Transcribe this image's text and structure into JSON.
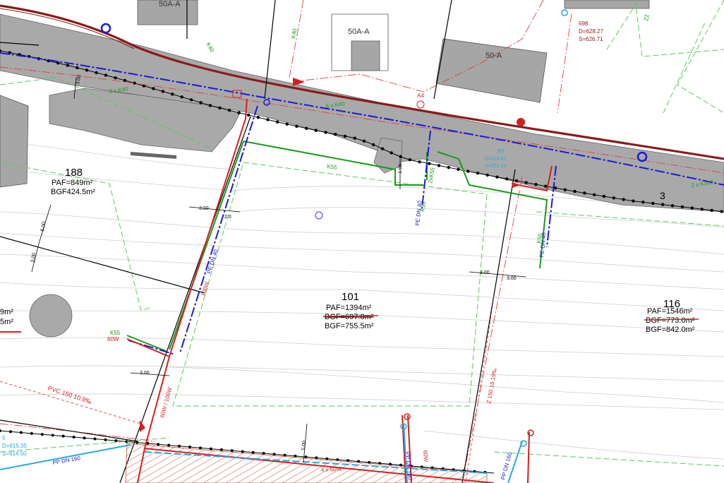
{
  "colors": {
    "road": "#a9a9a9",
    "building": "#a6a6a6",
    "parcel_line": "#000000",
    "contour": "#c8c8c8",
    "setback_green": "#5cc85c",
    "water_green": "#1a9a1a",
    "gas_blue": "#1a1ad6",
    "sewer_red": "#d42020",
    "main_road_edge": "#8b1a1a",
    "pp_cyan": "#29a8e0",
    "elec_red_dash": "#e04040"
  },
  "buildings": {
    "b50a_top": "50A-A",
    "b50a": "50A-A",
    "b50a_right": "50-A"
  },
  "parcels": {
    "p188": {
      "number": "188",
      "paf": "PAF=849m²",
      "bgf": "BGF424.5m²"
    },
    "p101": {
      "number": "101",
      "paf": "PAF=1394m²",
      "bgf_old": "BGF=697.0m²",
      "bgf": "BGF=755.5m²"
    },
    "p116": {
      "number": "116",
      "paf": "PAF=1546m²",
      "bgf_old": "BGF=773.0m²",
      "bgf": "BGF=842.0m²"
    },
    "p3": {
      "number": "3"
    },
    "left_partial": {
      "line1": "9m²",
      "line2": "5m²"
    }
  },
  "utilities": {
    "k40_top": "K40",
    "k40_left": "K40",
    "k40_2x": "2 x K40",
    "k40_6x": "6 x K40",
    "k55_main": "K55",
    "k55_2x": "2xK55",
    "k55_vert": "K55",
    "k55_right": "K55",
    "k100_2x": "2 x K100",
    "pe_dn40_left": "PE DN 40",
    "pe_dn40_mid": "PE DN 40",
    "pe_dn40_right": "PE DN 40",
    "w100": "100W",
    "w60_100": "60W / 100W",
    "k55_w60_a": "K55",
    "k55_w60_b": "60W",
    "pvc150": "PVC 150  10.9‰",
    "pp_dn160_left": "PP DN 160",
    "pp_dn160_mid": "PP DN 160",
    "pp_dn160_right": "PP DN 160",
    "w60_bottom": "60W",
    "w4x60": "4 x 60W",
    "z150": "Z 150  16.19‰",
    "a4": "A4",
    "z2": "Z2"
  },
  "manholes": {
    "m698": {
      "id": "698",
      "d": "D=628.27",
      "s": "S=626.71"
    },
    "m5": {
      "id": "5",
      "d": "D=615.35",
      "s": "S=614.50"
    },
    "mid": {
      "id": "8/8",
      "d": "D=624.01",
      "s": "S=623.10"
    }
  },
  "dimensions": {
    "d300_a": "3.00",
    "d300_b": "3.00",
    "d300_c": "3.00",
    "d300_d": "3.00",
    "d300_e": "3.00",
    "d500_a": "5.00",
    "d500_b": "5.00",
    "d300_v": "3.00",
    "d300_top": "3.00",
    "d100": "1.00",
    "d220": "2.0"
  }
}
